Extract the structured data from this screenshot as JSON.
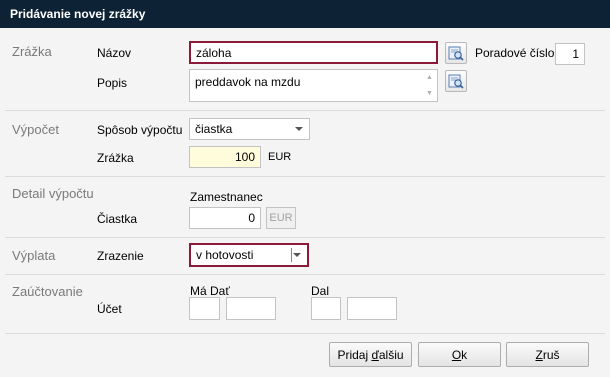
{
  "window": {
    "title": "Pridávanie novej zrážky"
  },
  "sections": {
    "zrazka": {
      "title": "Zrážka",
      "nazov_label": "Názov",
      "nazov_value": "záloha",
      "poradove_label": "Poradové číslo",
      "poradove_value": "1",
      "popis_label": "Popis",
      "popis_value": "preddavok na mzdu"
    },
    "vypocet": {
      "title": "Výpočet",
      "sposob_label": "Spôsob výpočtu",
      "sposob_value": "čiastka",
      "zrazka_label": "Zrážka",
      "zrazka_value": "100",
      "currency": "EUR"
    },
    "detail": {
      "title": "Detail výpočtu",
      "column_header": "Zamestnanec",
      "ciastka_label": "Čiastka",
      "ciastka_value": "0",
      "currency_button": "EUR"
    },
    "vyplata": {
      "title": "Výplata",
      "zarazenie_label": "Zrazenie",
      "zarazenie_value": "v hotovosti"
    },
    "zauctovanie": {
      "title": "Zaúčtovanie",
      "ucet_label": "Účet",
      "ma_dat_label": "Má Dať",
      "dal_label": "Dal",
      "ma_dat_1": "",
      "ma_dat_2": "",
      "dal_1": "",
      "dal_2": ""
    }
  },
  "buttons": {
    "pridaj_prefix": "Pridaj ",
    "pridaj_underlined": "ď",
    "pridaj_suffix": "alšiu",
    "ok_underlined": "O",
    "ok_suffix": "k",
    "zrus_underlined": "Z",
    "zrus_suffix": "ruš"
  },
  "icons": [
    "lookup-icon"
  ],
  "colors": {
    "titlebar": "#0d2335",
    "highlight_border": "#8b1a38",
    "yellow_field": "#fffcdc"
  }
}
